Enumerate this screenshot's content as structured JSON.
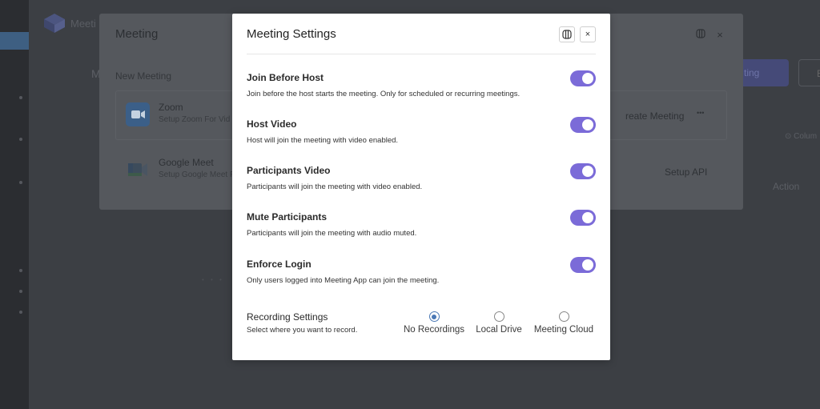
{
  "background": {
    "app_name": "Meeti",
    "letter": "M",
    "primary_button": "ting",
    "outline_button": "E",
    "columns_label": "Colum",
    "action_header": "Action"
  },
  "meeting_panel": {
    "title": "Meeting",
    "subtitle": "New Meeting",
    "integrations": [
      {
        "name": "Zoom",
        "description": "Setup Zoom For Vid",
        "action": "reate Meeting",
        "more": "•••"
      },
      {
        "name": "Google Meet",
        "description": "Setup Google Meet F",
        "action": "Setup API"
      }
    ]
  },
  "modal": {
    "title": "Meeting Settings",
    "close_symbol": "×",
    "settings": [
      {
        "label": "Join Before Host",
        "help": "Join before the host starts the meeting. Only for scheduled or recurring meetings.",
        "enabled": true
      },
      {
        "label": "Host Video",
        "help": "Host will join the meeting with video enabled.",
        "enabled": true
      },
      {
        "label": "Participants Video",
        "help": "Participants will join the meeting with video enabled.",
        "enabled": true
      },
      {
        "label": "Mute Participants",
        "help": "Participants will join the meeting with audio muted.",
        "enabled": true
      },
      {
        "label": "Enforce Login",
        "help": "Only users logged into Meeting App can join the meeting.",
        "enabled": true
      }
    ],
    "recording": {
      "label": "Recording Settings",
      "help": "Select where you want to record.",
      "options": [
        "No Recordings",
        "Local Drive",
        "Meeting Cloud"
      ],
      "selected": "No Recordings"
    }
  },
  "colors": {
    "toggle_on": "#7b6bd8",
    "radio_selected": "#4a78b5",
    "overlay": "#3c3f44"
  }
}
